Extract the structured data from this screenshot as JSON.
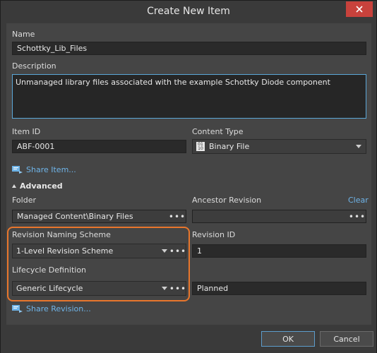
{
  "window": {
    "title": "Create New Item"
  },
  "name": {
    "label": "Name",
    "value": "Schottky_Lib_Files"
  },
  "description": {
    "label": "Description",
    "value": "Unmanaged library files associated with the example Schottky Diode component"
  },
  "item_id": {
    "label": "Item ID",
    "value": "ABF-0001"
  },
  "content_type": {
    "label": "Content Type",
    "value": "Binary File",
    "icon": "binary-file-icon"
  },
  "share_item": {
    "label": "Share Item..."
  },
  "advanced": {
    "label": "Advanced"
  },
  "folder": {
    "label": "Folder",
    "value": "Managed Content\\Binary Files"
  },
  "ancestor_revision": {
    "label": "Ancestor Revision",
    "clear_label": "Clear",
    "value": ""
  },
  "revision_naming": {
    "label": "Revision Naming Scheme",
    "value": "1-Level Revision Scheme"
  },
  "revision_id": {
    "label": "Revision ID",
    "value": "1"
  },
  "lifecycle": {
    "label": "Lifecycle Definition",
    "value": "Generic Lifecycle",
    "state": "Planned"
  },
  "share_revision": {
    "label": "Share Revision..."
  },
  "buttons": {
    "ok": "OK",
    "cancel": "Cancel"
  },
  "colors": {
    "accent": "#6fb4e8",
    "highlight": "#e8762c",
    "close": "#c8423c"
  }
}
